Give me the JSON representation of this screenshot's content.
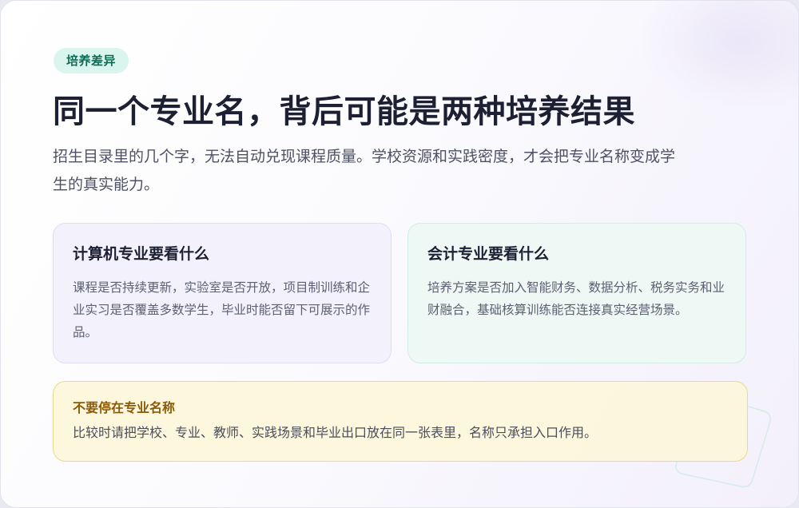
{
  "tag": "培养差异",
  "title": "同一个专业名，背后可能是两种培养结果",
  "subtitle": "招生目录里的几个字，无法自动兑现课程质量。学校资源和实践密度，才会把专业名称变成学生的真实能力。",
  "panels": [
    {
      "title": "计算机专业要看什么",
      "body": "课程是否持续更新，实验室是否开放，项目制训练和企业实习是否覆盖多数学生，毕业时能否留下可展示的作品。"
    },
    {
      "title": "会计专业要看什么",
      "body": "培养方案是否加入智能财务、数据分析、税务实务和业财融合，基础核算训练能否连接真实经营场景。"
    }
  ],
  "notice": {
    "title": "不要停在专业名称",
    "body": "比较时请把学校、专业、教师、实践场景和毕业出口放在同一张表里，名称只承担入口作用。"
  },
  "colors": {
    "accent_teal": "#0e6b54",
    "title": "#1d2033",
    "notice_title": "#8a5a08",
    "notice_bg": "#fdf6db"
  }
}
